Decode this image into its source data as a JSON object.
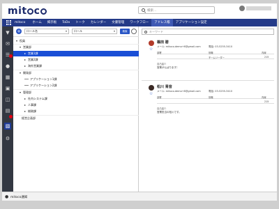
{
  "header": {
    "logo": "mitoco",
    "search_placeholder": "検索..."
  },
  "nav": {
    "brand": "mitoco",
    "items": [
      "ホーム",
      "掲示板",
      "ToDo",
      "トーク",
      "カレンダー",
      "文書管理",
      "ワークフロー",
      "アドレス帳",
      "アプリケーション設定"
    ],
    "active": "アドレス帳"
  },
  "toolbar": {
    "select_mode": "ロール名",
    "select_role": "ロール",
    "search_button": "検索"
  },
  "tree": [
    {
      "label": "役員",
      "level": 0,
      "icon": "down"
    },
    {
      "label": "営業部",
      "level": 1,
      "icon": "down"
    },
    {
      "label": "営業1課",
      "level": 2,
      "icon": "right",
      "selected": true
    },
    {
      "label": "営業2課",
      "level": 2,
      "icon": "right"
    },
    {
      "label": "海外営業課",
      "level": 2,
      "icon": "right"
    },
    {
      "label": "開発部",
      "level": 1,
      "icon": "down"
    },
    {
      "label": "アプリケーション1課",
      "level": 2,
      "icon": "dash"
    },
    {
      "label": "アプリケーション2課",
      "level": 2,
      "icon": "dash"
    },
    {
      "label": "管理部",
      "level": 1,
      "icon": "down"
    },
    {
      "label": "社内システム課",
      "level": 2,
      "icon": "right"
    },
    {
      "label": "人事課",
      "level": 2,
      "icon": "right"
    },
    {
      "label": "総務課",
      "level": 2,
      "icon": "right"
    },
    {
      "label": "経営企画部",
      "level": 1,
      "icon": "none"
    }
  ],
  "detail": {
    "keyword_placeholder": "キーワード",
    "columns": [
      "部署",
      "役職",
      "内線"
    ],
    "note_label": "自己紹介",
    "contacts": [
      {
        "name": "篠田 碧",
        "email": "メール: mitoco.demo+6@gmail.com",
        "phone": "電話: 03-5255-3410",
        "role": "チームリーダー",
        "ext": "215",
        "note": "営業がんばります！"
      },
      {
        "name": "松川 青音",
        "email": "メール: mitoco.demo+8@gmail.com",
        "phone": "電話: 03-5255-3410",
        "role": "",
        "ext": "215",
        "note": "営業担当の松川です。"
      }
    ]
  },
  "footer": {
    "notification": "mitoco通知"
  }
}
